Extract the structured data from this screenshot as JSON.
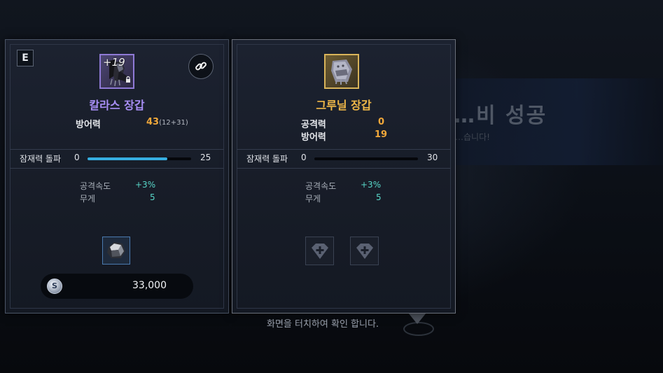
{
  "background": {
    "banner_title": "…비 성공",
    "banner_subtitle": "…습니다!",
    "hint_text": "화면을 터치하여 확인 합니다."
  },
  "left_panel": {
    "grade": "E",
    "enhance_level": "+19",
    "item_name": "칼라스 장갑",
    "stats": [
      {
        "label": "방어력",
        "value": "43",
        "extra": "(12+31)"
      }
    ],
    "potential": {
      "label": "잠재력 돌파",
      "min": "0",
      "max": "25",
      "progress": 0.77
    },
    "options": [
      {
        "label": "공격속도",
        "value": "+3%"
      },
      {
        "label": "무게",
        "value": "5"
      }
    ],
    "cost": "33,000",
    "colors": {
      "name": "#a88ef5",
      "frame": "#8f7ad6"
    },
    "icons": [
      "link-icon",
      "gloves-icon",
      "lock-icon",
      "ore-icon",
      "silver-coin-icon"
    ]
  },
  "right_panel": {
    "item_name": "그루닐 장갑",
    "stats": [
      {
        "label": "공격력",
        "value": "0"
      },
      {
        "label": "방어력",
        "value": "19"
      }
    ],
    "potential": {
      "label": "잠재력 돌파",
      "min": "0",
      "max": "30",
      "progress": 0
    },
    "options": [
      {
        "label": "공격속도",
        "value": "+3%"
      },
      {
        "label": "무게",
        "value": "5"
      }
    ],
    "colors": {
      "name": "#f0b848",
      "frame": "#d9b45a"
    },
    "icons": [
      "gauntlet-icon",
      "gem-slot-icon",
      "gem-slot-icon"
    ]
  },
  "accent_colors": {
    "stat_value": "#f2a83a",
    "option_value": "#58d7c9",
    "progress": "#36aee0"
  }
}
